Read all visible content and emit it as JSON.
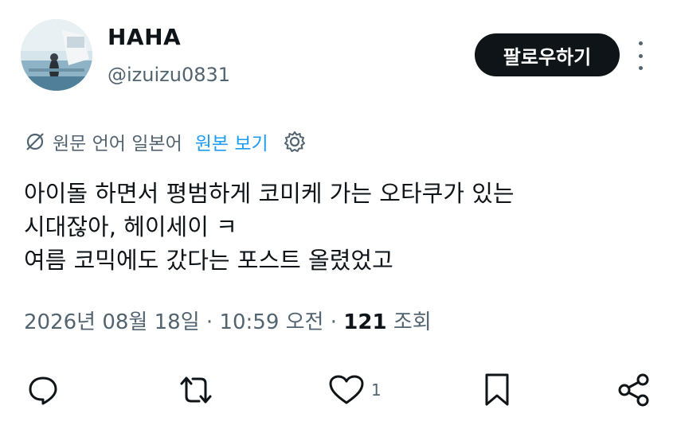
{
  "author": {
    "name": "HAHA",
    "handle": "@izuizu0831",
    "avatar_icon": "profile-photo"
  },
  "follow_button": {
    "label": "팔로우하기"
  },
  "more_menu": {
    "icon": "more-vertical-icon"
  },
  "translation": {
    "original_language": "원문 언어 일본어",
    "view_original": "원본 보기",
    "settings_icon": "gear-icon"
  },
  "tweet": {
    "lines": [
      "아이돌 하면서 평범하게 코미케 가는 오타쿠가 있는",
      "시대잖아, 헤이세이 ㅋ",
      "여름 코믹에도 갔다는 포스트 올렸었고"
    ]
  },
  "meta": {
    "date": "2026년 08월 18일",
    "separator1": " · ",
    "time": "10:59 오전",
    "separator2": " · ",
    "views_count": "121",
    "views_label": " 조회"
  },
  "actions": {
    "reply": {
      "icon": "reply-icon"
    },
    "retweet": {
      "icon": "retweet-icon"
    },
    "like": {
      "icon": "heart-icon",
      "count": "1"
    },
    "bookmark": {
      "icon": "bookmark-icon"
    },
    "share": {
      "icon": "share-icon"
    }
  },
  "colors": {
    "text": "#0f1419",
    "secondary": "#536471",
    "link": "#1d9bf0",
    "button_bg": "#0f1419"
  }
}
